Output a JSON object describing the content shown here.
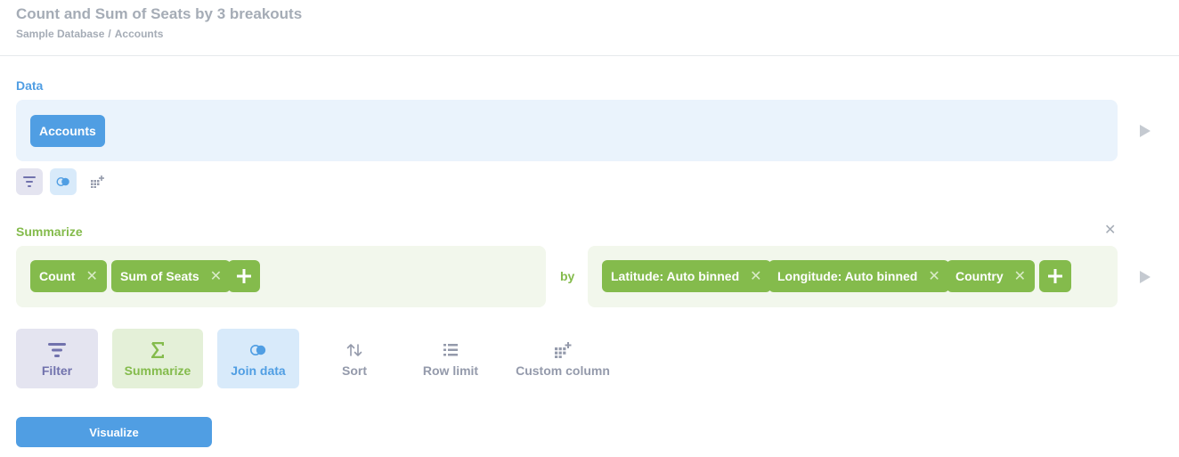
{
  "header": {
    "title": "Count and Sum of Seats by 3 breakouts",
    "breadcrumb": [
      "Sample Database",
      "Accounts"
    ],
    "breadcrumb_separator": "/"
  },
  "data_section": {
    "label": "Data",
    "table_pill": "Accounts"
  },
  "summarize_section": {
    "label": "Summarize",
    "metrics": [
      "Count",
      "Sum of Seats"
    ],
    "by_label": "by",
    "breakouts": [
      "Latitude: Auto binned",
      "Longitude: Auto binned",
      "Country"
    ]
  },
  "actions": [
    {
      "label": "Filter",
      "icon": "filter-icon"
    },
    {
      "label": "Summarize",
      "icon": "sigma-icon"
    },
    {
      "label": "Join data",
      "icon": "join-icon"
    },
    {
      "label": "Sort",
      "icon": "sort-icon"
    },
    {
      "label": "Row limit",
      "icon": "list-icon"
    },
    {
      "label": "Custom column",
      "icon": "add-column-icon"
    }
  ],
  "visualize_label": "Visualize",
  "colors": {
    "brand_blue": "#509ee3",
    "summarize_green": "#84bb4c",
    "filter_purple": "#7172ad",
    "muted_text": "#a5acb6"
  }
}
